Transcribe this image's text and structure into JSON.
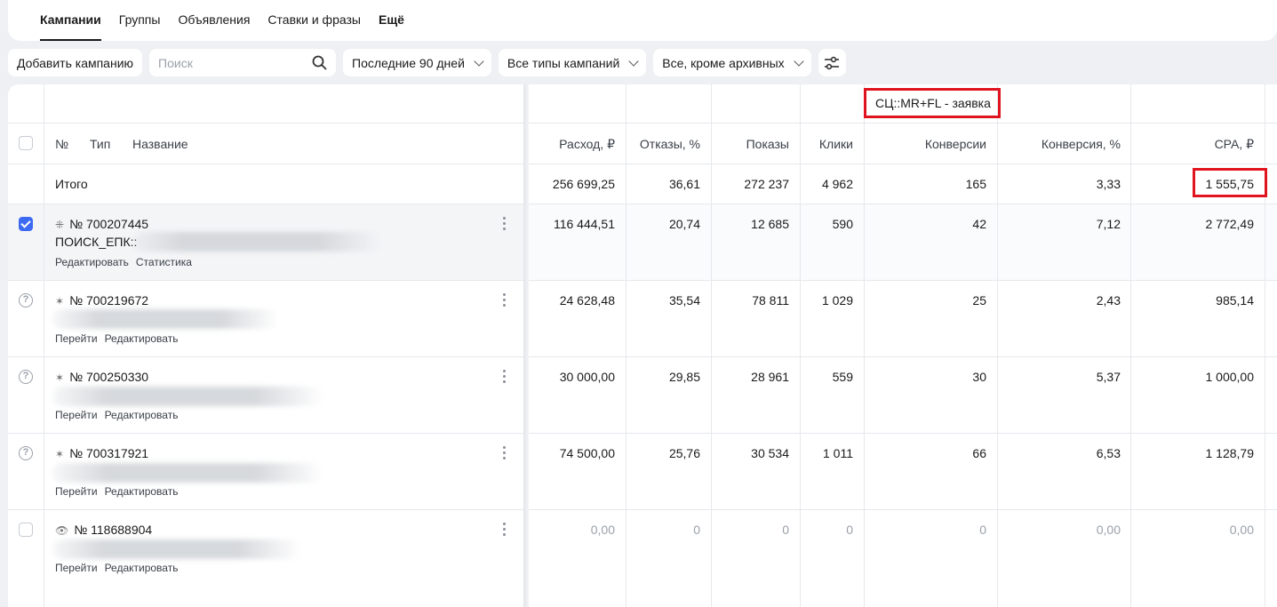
{
  "tabs": [
    {
      "label": "Кампании",
      "active": true
    },
    {
      "label": "Группы"
    },
    {
      "label": "Объявления"
    },
    {
      "label": "Ставки и фразы"
    },
    {
      "label": "Ещё"
    }
  ],
  "toolbar": {
    "add_campaign": "Добавить кампанию",
    "search_placeholder": "Поиск",
    "period": "Последние 90 дней",
    "campaign_types": "Все типы кампаний",
    "status_filter": "Все, кроме архивных"
  },
  "table": {
    "goal_header": "СЦ::MR+FL - заявка",
    "columns": {
      "number": "№",
      "type": "Тип",
      "name": "Название",
      "spend": "Расход, ₽",
      "bounce": "Отказы, %",
      "impressions": "Показы",
      "clicks": "Клики",
      "conversions": "Конверсии",
      "conversion_rate": "Конверсия, %",
      "cpa": "CPA, ₽"
    },
    "total": {
      "label": "Итого",
      "spend": "256 699,25",
      "bounce": "36,61",
      "impressions": "272 237",
      "clicks": "4 962",
      "conversions": "165",
      "conversion_rate": "3,33",
      "cpa": "1 555,75"
    },
    "rows": [
      {
        "id": "№ 700207445",
        "name": "ПОИСК_ЕПК::",
        "links": [
          "Редактировать",
          "Статистика"
        ],
        "spend": "116 444,51",
        "bounce": "20,74",
        "impressions": "12 685",
        "clicks": "590",
        "conversions": "42",
        "conversion_rate": "7,12",
        "cpa": "2 772,49",
        "checked": true
      },
      {
        "id": "№ 700219672",
        "name": "",
        "links": [
          "Перейти",
          "Редактировать"
        ],
        "spend": "24 628,48",
        "bounce": "35,54",
        "impressions": "78 811",
        "clicks": "1 029",
        "conversions": "25",
        "conversion_rate": "2,43",
        "cpa": "985,14"
      },
      {
        "id": "№ 700250330",
        "name": "",
        "links": [
          "Перейти",
          "Редактировать"
        ],
        "spend": "30 000,00",
        "bounce": "29,85",
        "impressions": "28 961",
        "clicks": "559",
        "conversions": "30",
        "conversion_rate": "5,37",
        "cpa": "1 000,00"
      },
      {
        "id": "№ 700317921",
        "name": "",
        "links": [
          "Перейти",
          "Редактировать"
        ],
        "spend": "74 500,00",
        "bounce": "25,76",
        "impressions": "30 534",
        "clicks": "1 011",
        "conversions": "66",
        "conversion_rate": "6,53",
        "cpa": "1 128,79"
      },
      {
        "id": "№ 118688904",
        "name": "",
        "links": [
          "Перейти",
          "Редактировать"
        ],
        "spend": "0,00",
        "bounce": "0",
        "impressions": "0",
        "clicks": "0",
        "conversions": "0",
        "conversion_rate": "0,00",
        "cpa": "0,00",
        "muted": true
      }
    ]
  }
}
